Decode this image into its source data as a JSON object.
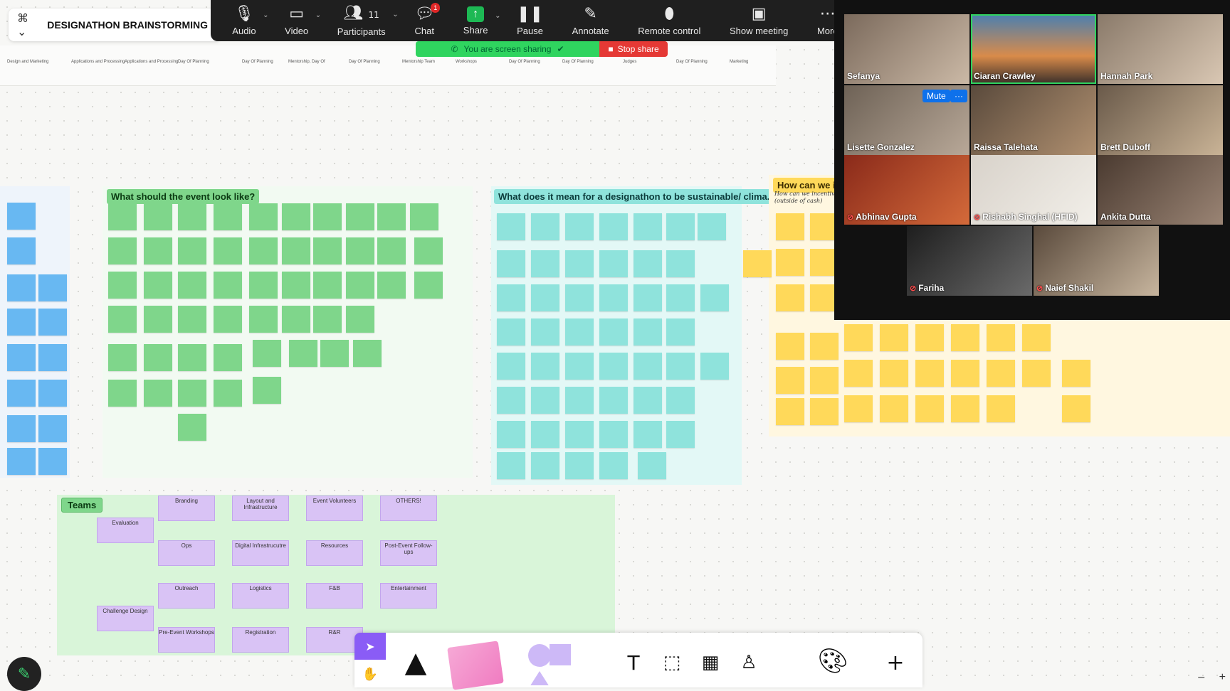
{
  "document": {
    "title": "DESIGNATHON BRAINSTORMING SE"
  },
  "strip_labels": [
    "Design and Marketing",
    "Applications and Processing",
    "Applications and Processing",
    "Day Of Planning",
    "Day Of Planning",
    "Mentorship, Day Of",
    "Day Of Planning",
    "Mentorship Team",
    "Workshops",
    "Day Of Planning",
    "Day Of Planning",
    "Judges",
    "Day Of Planning",
    "Marketing"
  ],
  "zoom_toolbar": {
    "items": [
      {
        "id": "audio",
        "label": "Audio",
        "icon": "microphone-icon",
        "glyph": "🎙︎",
        "caret": true
      },
      {
        "id": "video",
        "label": "Video",
        "icon": "video-camera-icon",
        "glyph": "▭",
        "caret": true
      },
      {
        "id": "participants",
        "label": "Participants",
        "icon": "participants-icon",
        "glyph": "👥︎",
        "count": "11",
        "caret": true
      },
      {
        "id": "chat",
        "label": "Chat",
        "icon": "chat-icon",
        "glyph": "💬︎",
        "badge": "1"
      },
      {
        "id": "share",
        "label": "Share",
        "icon": "share-screen-icon",
        "glyph": "↑",
        "caret": true
      },
      {
        "id": "pause",
        "label": "Pause",
        "icon": "pause-icon",
        "glyph": "❚❚"
      },
      {
        "id": "annotate",
        "label": "Annotate",
        "icon": "pencil-icon",
        "glyph": "✎"
      },
      {
        "id": "remote",
        "label": "Remote control",
        "icon": "mouse-icon",
        "glyph": "⌂"
      },
      {
        "id": "show",
        "label": "Show meeting",
        "icon": "show-meeting-icon",
        "glyph": "▣"
      },
      {
        "id": "more",
        "label": "More",
        "icon": "more-icon",
        "glyph": "⋯"
      }
    ]
  },
  "sharing": {
    "status": "You are screen sharing",
    "stop_label": "Stop share"
  },
  "sections": {
    "event_look": "What should the event look like?",
    "sustainable": "What does it mean for a designathon to be sustainable/ clima...",
    "incentive": "How can we inc",
    "incentive_sub": "How can we incentiv (outside of cash)",
    "teams": "Teams"
  },
  "teams": [
    {
      "name": "Evaluation"
    },
    {
      "name": "Branding"
    },
    {
      "name": "Layout and Infrastructure"
    },
    {
      "name": "Event Volunteers"
    },
    {
      "name": "OTHERS!"
    },
    {
      "name": "Ops"
    },
    {
      "name": "Digital Infrastrucutre"
    },
    {
      "name": "Resources"
    },
    {
      "name": "Post-Event Follow-ups"
    },
    {
      "name": "Outreach"
    },
    {
      "name": "Logistics"
    },
    {
      "name": "F&B"
    },
    {
      "name": "Entertainment"
    },
    {
      "name": "Challenge Design"
    },
    {
      "name": "Pre-Event Workshops"
    },
    {
      "name": "Registration"
    },
    {
      "name": "R&R"
    }
  ],
  "participants": [
    {
      "name": "Sefanya",
      "muted": false
    },
    {
      "name": "Ciaran Crawley",
      "muted": false,
      "active": true
    },
    {
      "name": "Hannah Park",
      "muted": false
    },
    {
      "name": "Lisette Gonzalez",
      "muted": false
    },
    {
      "name": "Raissa Talehata",
      "muted": false
    },
    {
      "name": "Brett Duboff",
      "muted": false
    },
    {
      "name": "Abhinav Gupta",
      "muted": true
    },
    {
      "name": "Rishabh Singhal (HFID)",
      "muted": true
    },
    {
      "name": "Ankita Dutta",
      "muted": false
    },
    {
      "name": "Fariha",
      "muted": true
    },
    {
      "name": "Naief Shakil",
      "muted": true
    }
  ],
  "participant_controls": {
    "mute_label": "Mute",
    "more_label": "···"
  },
  "colors": {
    "zoom_bar": "#1f1f1f",
    "share_green": "#2fd45f",
    "stop_red": "#e53935",
    "sticky_green": "#7fd68b",
    "sticky_teal": "#8fe3dc",
    "sticky_yellow": "#ffd95a",
    "sticky_blue": "#68b8f2",
    "team_box": "#d9c3f5",
    "active_speaker": "#2fd45f"
  },
  "bottom_tools": [
    {
      "id": "select",
      "icon": "cursor-icon"
    },
    {
      "id": "hand",
      "icon": "hand-icon"
    },
    {
      "id": "marker",
      "icon": "marker-icon"
    },
    {
      "id": "sticky",
      "icon": "sticky-note-icon"
    },
    {
      "id": "shapes",
      "icon": "shapes-icon"
    },
    {
      "id": "text",
      "icon": "text-icon"
    },
    {
      "id": "section",
      "icon": "section-icon"
    },
    {
      "id": "table",
      "icon": "table-icon"
    },
    {
      "id": "stamp",
      "icon": "stamp-icon"
    },
    {
      "id": "stickers",
      "icon": "stickers-icon"
    },
    {
      "id": "add",
      "icon": "plus-icon"
    }
  ],
  "zoom_controls": {
    "minus": "–",
    "plus": "+"
  }
}
